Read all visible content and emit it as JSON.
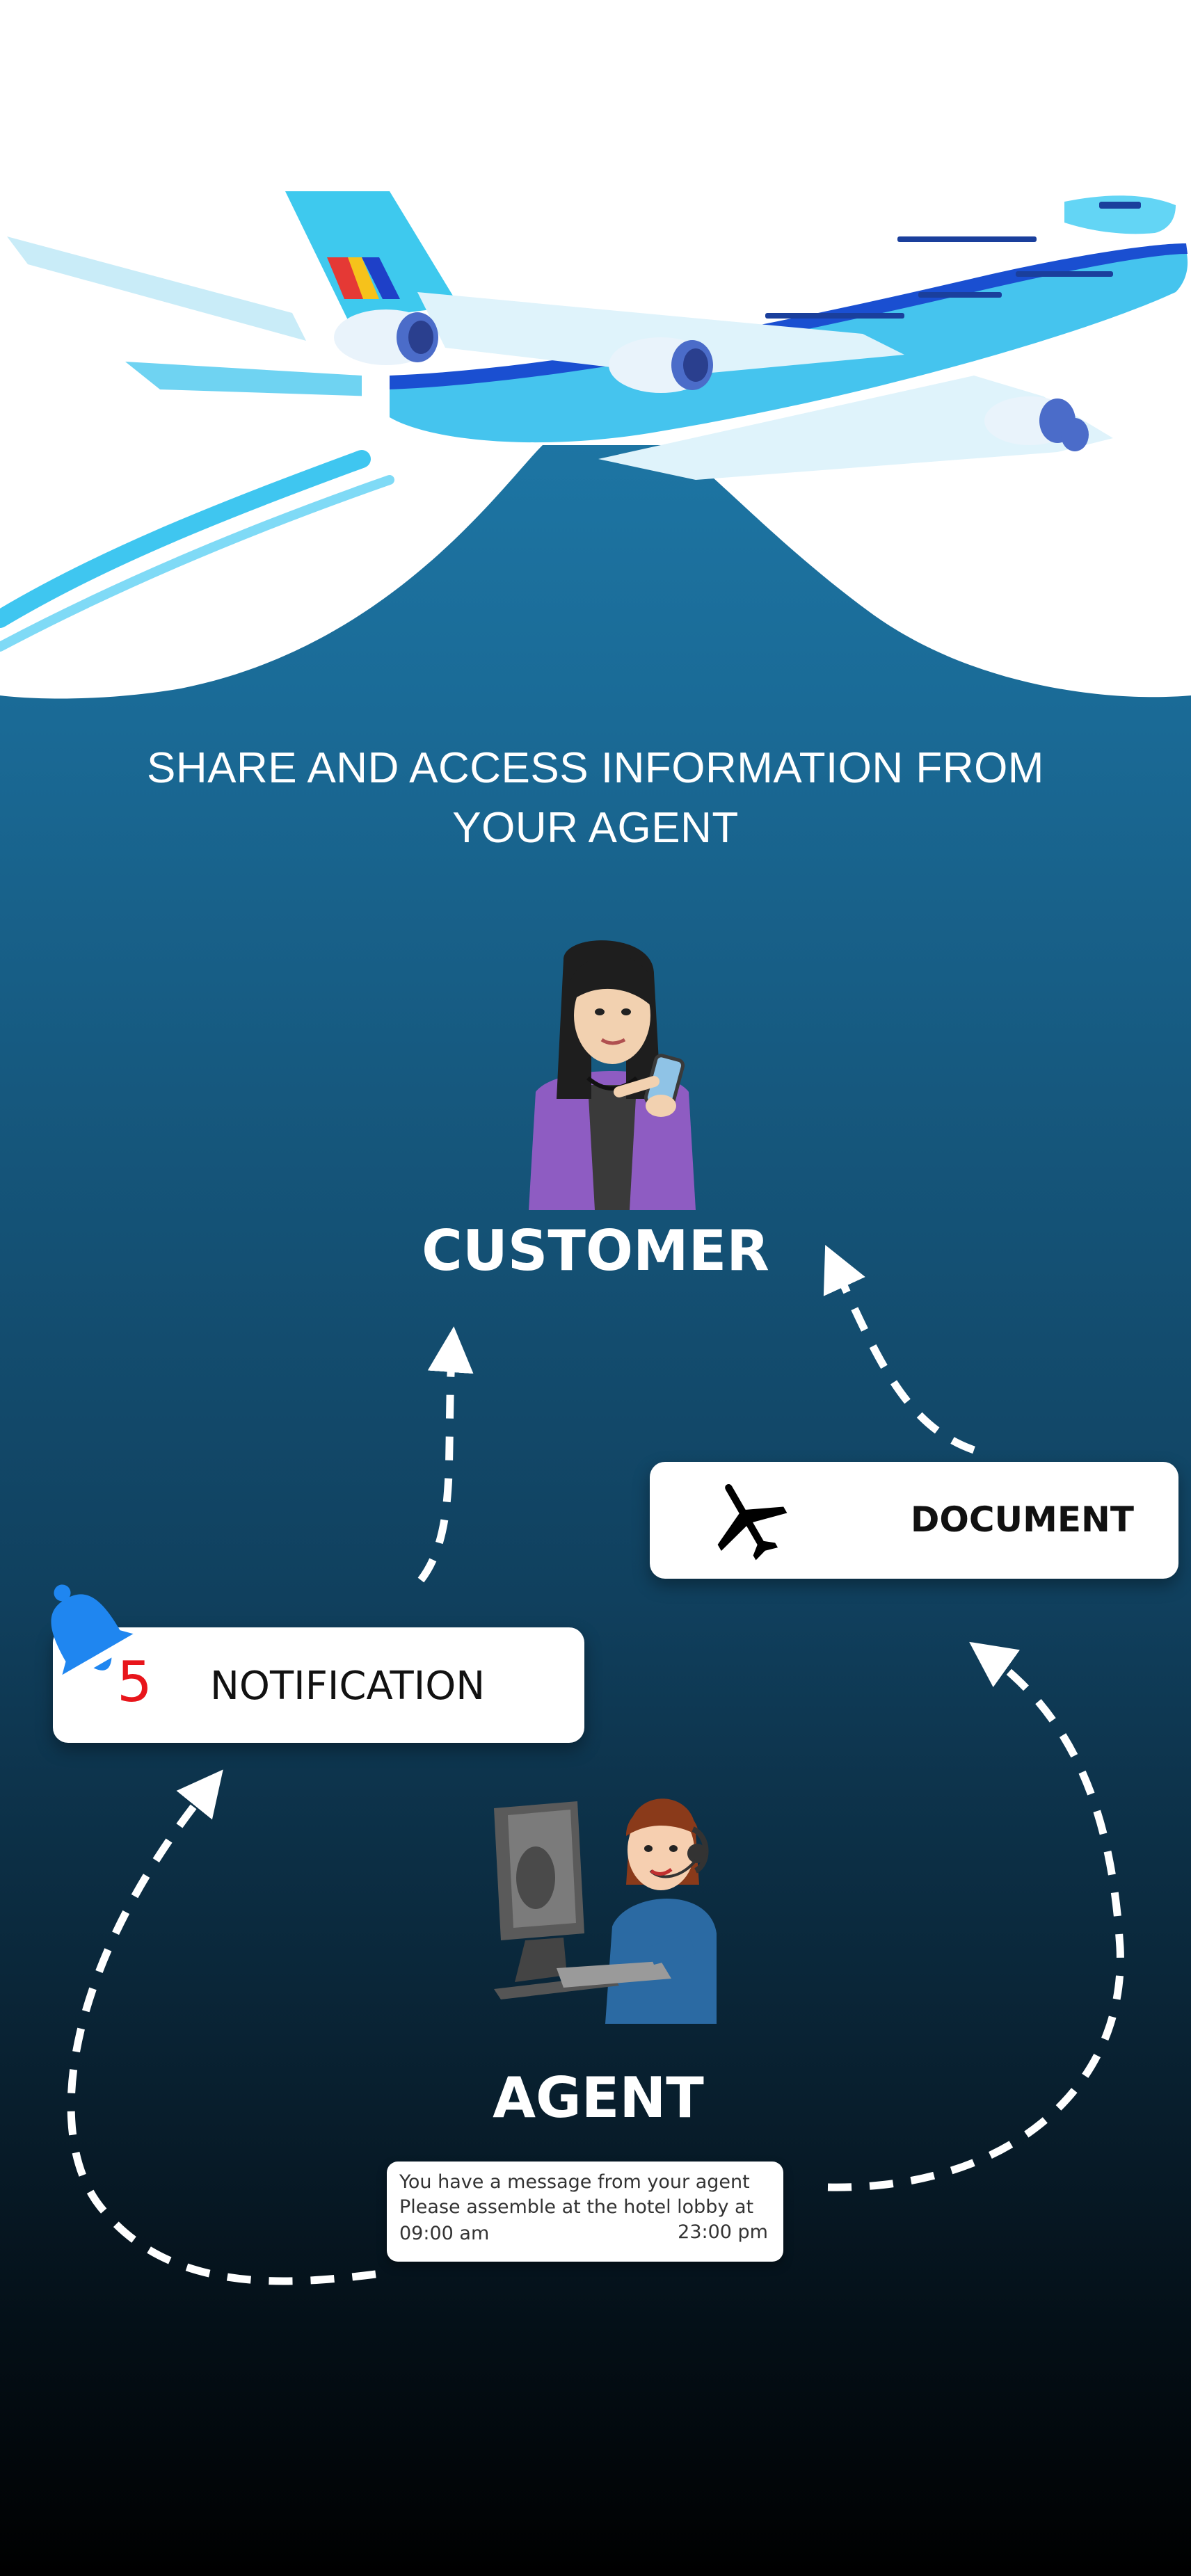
{
  "headline": {
    "line1": "SHARE AND ACCESS INFORMATION FROM",
    "line2": "YOUR AGENT"
  },
  "customer": {
    "label": "CUSTOMER"
  },
  "document_card": {
    "label": "DOCUMENT",
    "icon": "airplane-icon"
  },
  "notification_card": {
    "label": "NOTIFICATION",
    "count": "5",
    "icon": "bell-icon"
  },
  "agent": {
    "label": "AGENT"
  },
  "message": {
    "line1": "You have a message from your agent",
    "line2": "Please assemble at the hotel lobby at",
    "line3": "09:00 am",
    "time": "23:00 pm"
  },
  "colors": {
    "bg_top": "#2286b8",
    "bg_bottom": "#000000",
    "bell": "#1f86f0",
    "count": "#e8151b",
    "card": "#ffffff"
  }
}
